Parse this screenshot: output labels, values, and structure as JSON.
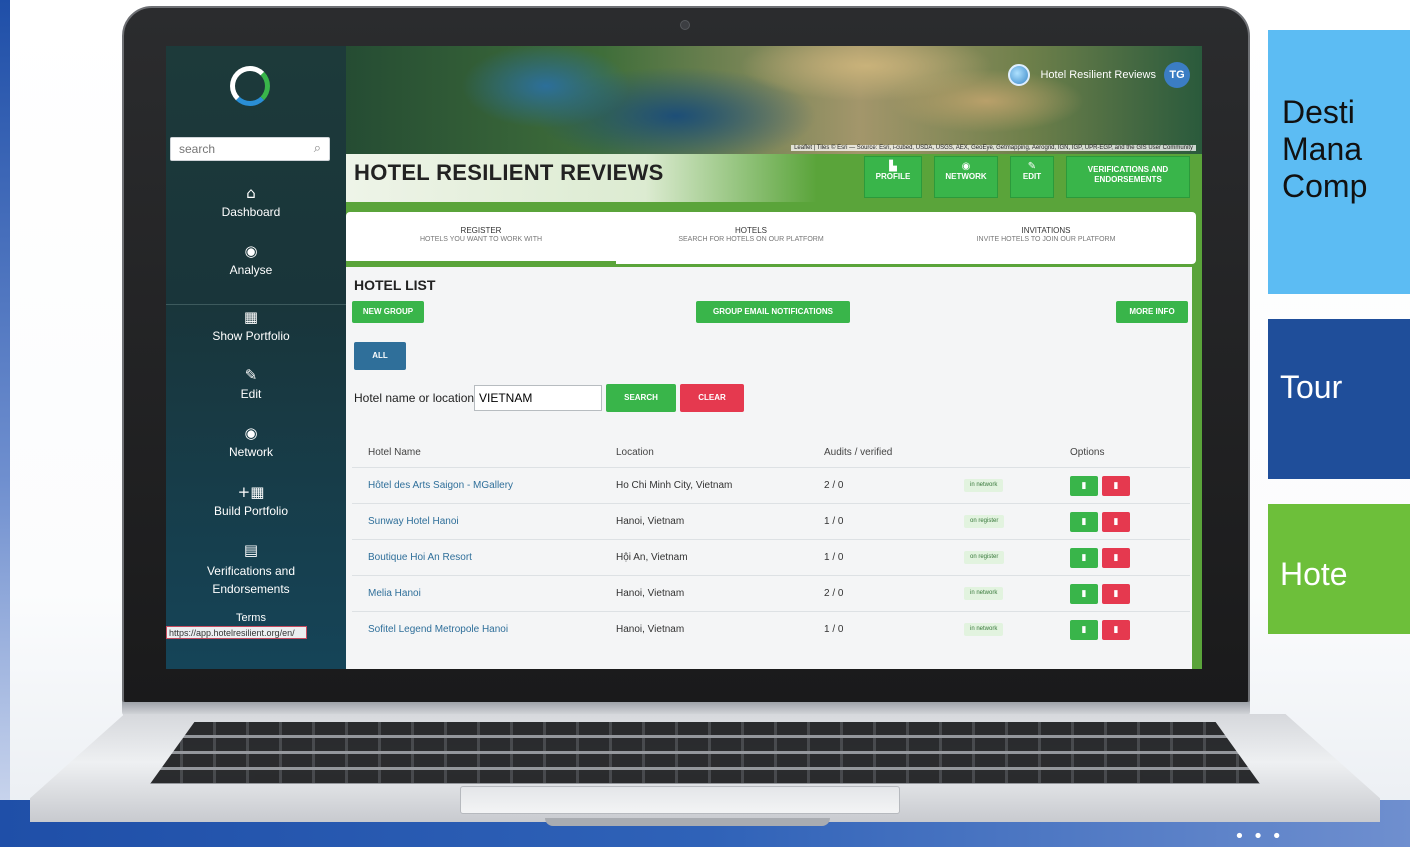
{
  "app": {
    "search_placeholder": "search",
    "status_url": "https://app.hotelresilient.org/en/",
    "brand_name": "Hotel Resilient Reviews",
    "avatar_initials": "TG",
    "map_attribution": "Leaflet | Tiles © Esri — Source: Esri, i-cubed, USDA, USGS, AEX, GeoEye, Getmapping, Aerogrid, IGN, IGP, UPR-EGP, and the GIS User Community"
  },
  "sidebar": {
    "items": [
      {
        "label": "Dashboard",
        "icon": "home-icon"
      },
      {
        "label": "Analyse",
        "icon": "globe-icon"
      },
      {
        "label": "Show Portfolio",
        "icon": "building-icon"
      },
      {
        "label": "Edit",
        "icon": "edit-icon"
      },
      {
        "label": "Network",
        "icon": "globe-icon"
      },
      {
        "label": "Build Portfolio",
        "icon": "add-building-icon"
      },
      {
        "label": "Verifications and Endorsements",
        "icon": "clipboard-icon"
      }
    ],
    "terms_label": "Terms"
  },
  "header": {
    "title": "HOTEL RESILIENT REVIEWS",
    "buttons": [
      {
        "label": "PROFILE",
        "icon": "profile-icon"
      },
      {
        "label": "NETWORK",
        "icon": "globe-icon"
      },
      {
        "label": "EDIT",
        "icon": "edit-icon"
      },
      {
        "label": "VERIFICATIONS AND ENDORSEMENTS",
        "icon": ""
      }
    ]
  },
  "tabs": [
    {
      "label": "REGISTER",
      "sub": "HOTELS YOU WANT TO WORK WITH",
      "active": true
    },
    {
      "label": "HOTELS",
      "sub": "SEARCH FOR HOTELS ON OUR PLATFORM",
      "active": false
    },
    {
      "label": "INVITATIONS",
      "sub": "INVITE HOTELS TO JOIN OUR PLATFORM",
      "active": false
    }
  ],
  "hotel_list": {
    "title": "HOTEL LIST",
    "new_group": "NEW GROUP",
    "group_email": "GROUP EMAIL NOTIFICATIONS",
    "more_info": "MORE INFO",
    "all": "ALL",
    "search_label": "Hotel name or location:",
    "search_value": "VIETNAM",
    "search_btn": "SEARCH",
    "clear_btn": "CLEAR",
    "columns": {
      "name": "Hotel Name",
      "location": "Location",
      "audits": "Audits / verified",
      "options": "Options"
    },
    "rows": [
      {
        "name": "Hôtel des Arts Saigon - MGallery",
        "location": "Ho Chi Minh City, Vietnam",
        "audits": "2 / 0",
        "status": "in network"
      },
      {
        "name": "Sunway Hotel Hanoi",
        "location": "Hanoi, Vietnam",
        "audits": "1 / 0",
        "status": "on register"
      },
      {
        "name": "Boutique Hoi An Resort",
        "location": "Hội An, Vietnam",
        "audits": "1 / 0",
        "status": "on register"
      },
      {
        "name": "Melia Hanoi",
        "location": "Hanoi, Vietnam",
        "audits": "2 / 0",
        "status": "in network"
      },
      {
        "name": "Sofitel Legend Metropole Hanoi",
        "location": "Hanoi, Vietnam",
        "audits": "1 / 0",
        "status": "in network"
      }
    ]
  },
  "side_cards": {
    "destination": "Desti\nMana\nComp",
    "tour": "Tour",
    "hotel": "Hote"
  },
  "colors": {
    "accent_green": "#5aa43a",
    "button_green": "#39b54a",
    "danger_red": "#e5394f",
    "link_blue": "#2f6f9a",
    "card_light_blue": "#5cbcf3",
    "card_dark_blue": "#1f4e9a",
    "card_green": "#6dbf3a"
  }
}
